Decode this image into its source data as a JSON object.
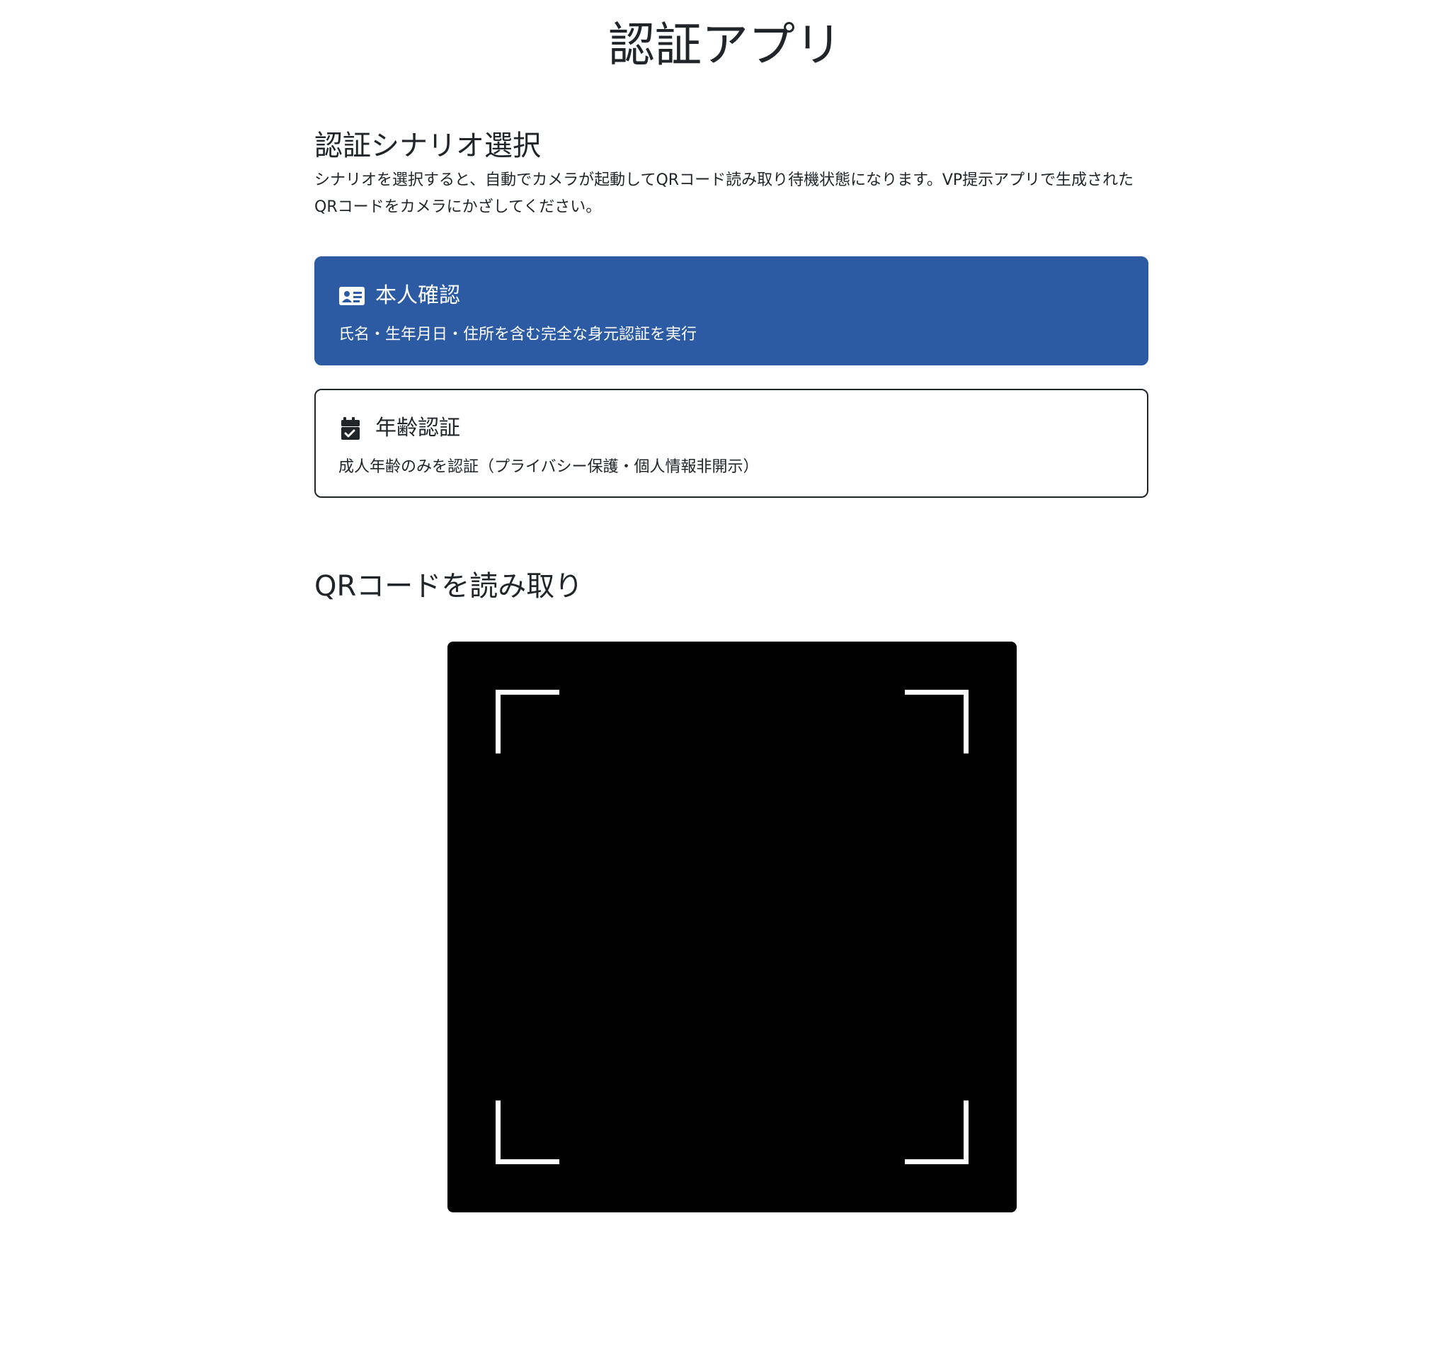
{
  "app": {
    "title": "認証アプリ"
  },
  "scenario_section": {
    "heading": "認証シナリオ選択",
    "description": "シナリオを選択すると、自動でカメラが起動してQRコード読み取り待機状態になります。VP提示アプリで生成されたQRコードをカメラにかざしてください。"
  },
  "scenarios": [
    {
      "icon": "id-card-icon",
      "title": "本人確認",
      "subtitle": "氏名・生年月日・住所を含む完全な身元認証を実行",
      "selected": true
    },
    {
      "icon": "calendar-check-icon",
      "title": "年齢認証",
      "subtitle": "成人年齢のみを認証（プライバシー保護・個人情報非開示）",
      "selected": false
    }
  ],
  "qr_section": {
    "heading": "QRコードを読み取り"
  },
  "colors": {
    "selected_card_bg": "#2d5ba3",
    "text": "#212529",
    "scanner_bg": "#000000",
    "scanner_frame": "#ffffff"
  }
}
